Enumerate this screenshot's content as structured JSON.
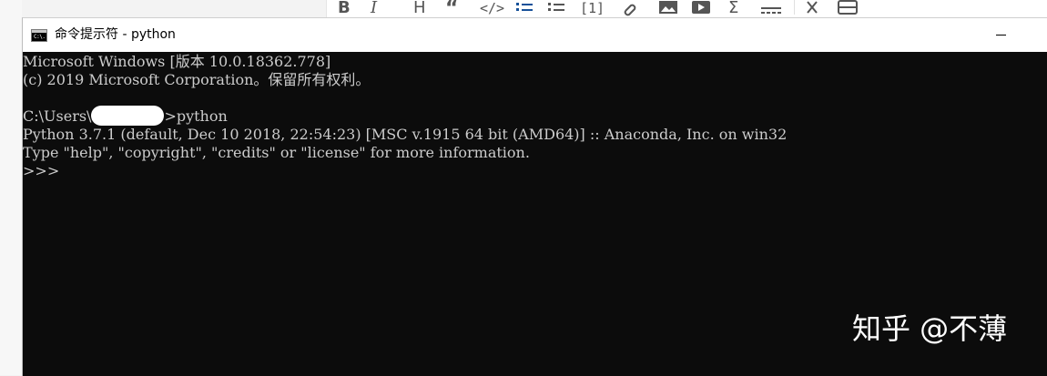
{
  "window": {
    "title": "命令提示符 - python",
    "icon_text": "C:\\."
  },
  "console": {
    "lines": {
      "l1": "Microsoft Windows [版本 10.0.18362.778]",
      "l2": "(c) 2019 Microsoft Corporation。保留所有权利。",
      "l3_prefix": "C:\\Users\\",
      "l3_suffix": ">python",
      "l4": "Python 3.7.1 (default, Dec 10 2018, 22:54:23) [MSC v.1915 64 bit (AMD64)] :: Anaconda, Inc. on win32",
      "l5": "Type \"help\", \"copyright\", \"credits\" or \"license\" for more information.",
      "l6": ">>>"
    }
  },
  "watermark": {
    "text": "知乎 @不薄"
  },
  "toolbar": {
    "icons": [
      "bold-icon",
      "italic-icon",
      "heading-icon",
      "quote-icon",
      "code-icon",
      "ordered-list-icon",
      "unordered-list-icon",
      "footnote-icon",
      "link-icon",
      "image-icon",
      "video-icon",
      "formula-icon",
      "divider-icon",
      "clear-format-icon",
      "table-icon"
    ]
  },
  "colors": {
    "console_bg": "#0c0c0c",
    "console_fg": "#cccccc",
    "titlebar_bg": "#ffffff",
    "toolbar_icon": "#555555"
  }
}
